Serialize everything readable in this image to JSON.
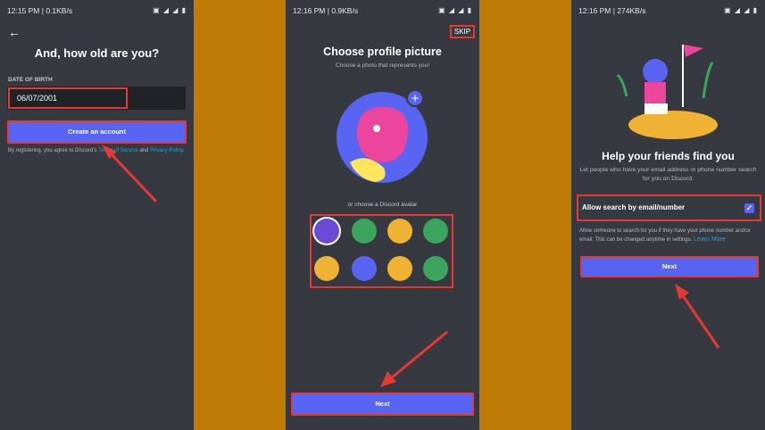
{
  "screen1": {
    "status_time": "12:15 PM | 0.1KB/s",
    "title": "And, how old are you?",
    "dob_label": "DATE OF BIRTH",
    "dob_value": "06/07/2001",
    "create_button": "Create an account",
    "legal_prefix": "By registering, you agree to Discord's",
    "legal_terms": "Terms of Service",
    "legal_and": "and",
    "legal_privacy": "Privacy Policy",
    "legal_end": "."
  },
  "screen2": {
    "status_time": "12:16 PM | 0.9KB/s",
    "skip": "SKIP",
    "title": "Choose profile picture",
    "subtitle": "Choose a photo that represents you!",
    "or_choose": "or choose a Discord avatar",
    "next": "Next",
    "avatars": [
      "#6b4ad6",
      "#3ba55d",
      "#f0b232",
      "#3ba55d",
      "#f0b232",
      "#5865f2",
      "#f0b232",
      "#3ba55d"
    ]
  },
  "screen3": {
    "status_time": "12:16 PM | 274KB/s",
    "title": "Help your friends find you",
    "subtitle": "Let people who have your email address or phone number search for you on Discord.",
    "allow_label": "Allow search by email/number",
    "allow_help": "Allow someone to search for you if they have your phone number and/or email. This can be changed anytime in settings.",
    "learn_more": "Learn More",
    "next": "Next"
  },
  "colors": {
    "accent": "#5865f2",
    "highlight": "#e53935",
    "background": "#c07a06",
    "phone_bg": "#36393f"
  }
}
